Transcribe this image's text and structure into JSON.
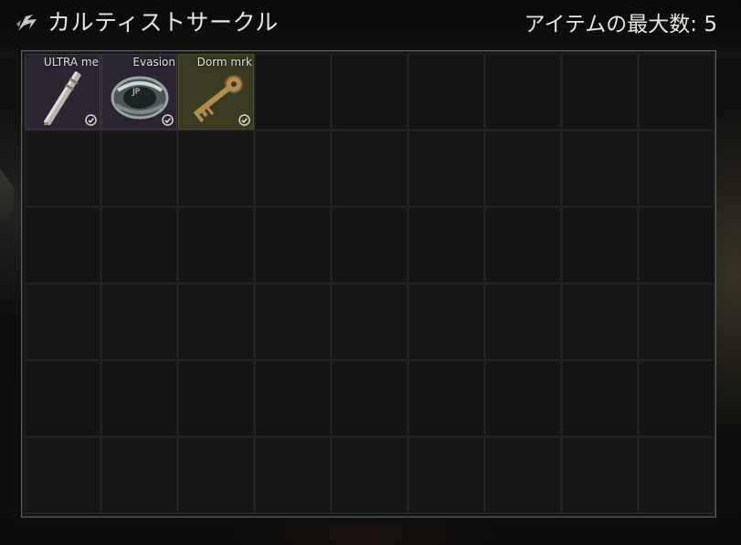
{
  "header": {
    "title": "カルティストサークル",
    "max_items": "アイテムの最大数: 5"
  },
  "grid": {
    "columns": 9,
    "rows": 6
  },
  "items": [
    {
      "label": "ULTRA me",
      "icon": "medicine-injector-icon",
      "color": "#2d2433"
    },
    {
      "label": "Evasion",
      "icon": "armband-icon",
      "color": "#2d2433"
    },
    {
      "label": "Dorm mrk",
      "icon": "key-icon",
      "color": "#3b3b22"
    }
  ],
  "colors": {
    "panel_border": "#5a5e5a",
    "text": "#e6e6e2",
    "purple_rarity": "#2d2433",
    "yellow_rarity": "#3b3b22"
  }
}
